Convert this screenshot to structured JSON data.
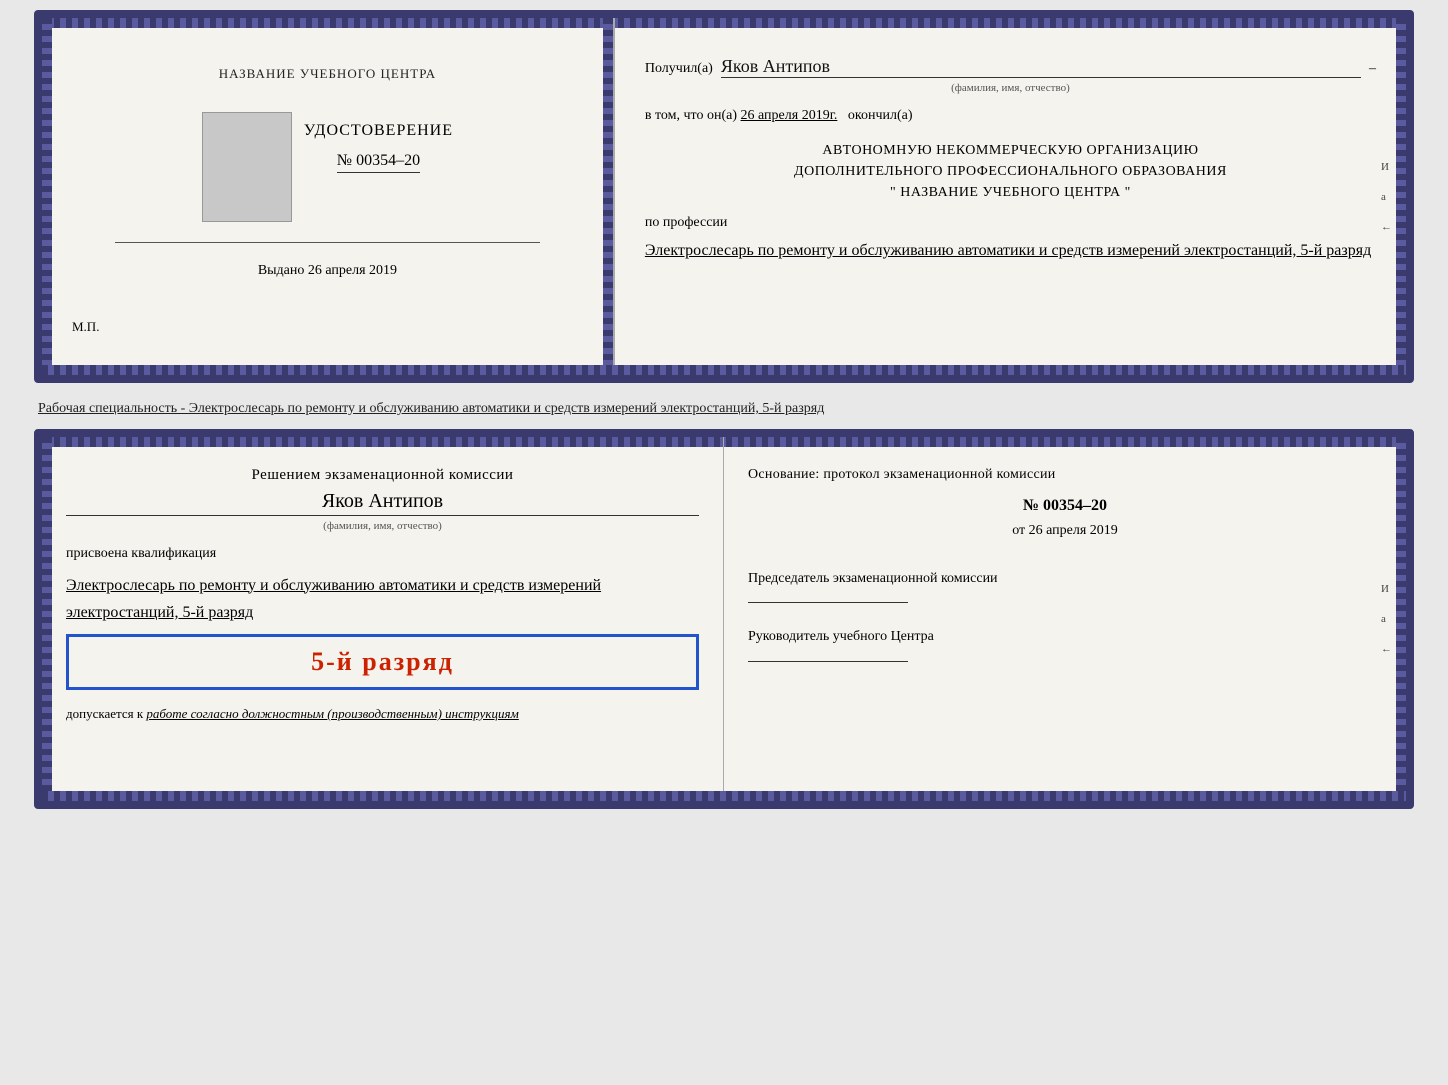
{
  "top_cert": {
    "left": {
      "org_name": "НАЗВАНИЕ УЧЕБНОГО ЦЕНТРА",
      "cert_title": "УДОСТОВЕРЕНИЕ",
      "cert_number": "№ 00354–20",
      "issued_label": "Выдано",
      "issued_date": "26 апреля 2019",
      "mp_label": "М.П."
    },
    "right": {
      "recipient_label": "Получил(а)",
      "recipient_name": "Яков Антипов",
      "fio_caption": "(фамилия, имя, отчество)",
      "completed_prefix": "в том, что он(а)",
      "completed_date": "26 апреля 2019г.",
      "completed_suffix": "окончил(а)",
      "org_line1": "АВТОНОМНУЮ НЕКОММЕРЧЕСКУЮ ОРГАНИЗАЦИЮ",
      "org_line2": "ДОПОЛНИТЕЛЬНОГО ПРОФЕССИОНАЛЬНОГО ОБРАЗОВАНИЯ",
      "org_line3": "\" НАЗВАНИЕ УЧЕБНОГО ЦЕНТРА \"",
      "profession_label": "по профессии",
      "profession_text": "Электрослесарь по ремонту и обслуживанию автоматики и средств измерений электростанций, 5-й разряд"
    }
  },
  "description": {
    "text": "Рабочая специальность - Электрослесарь по ремонту и обслуживанию автоматики и средств измерений электростанций, 5-й разряд"
  },
  "bottom_cert": {
    "left": {
      "decision_text": "Решением экзаменационной комиссии",
      "name": "Яков Антипов",
      "fio_caption": "(фамилия, имя, отчество)",
      "qualification_label": "присвоена квалификация",
      "qualification_text": "Электрослесарь по ремонту и обслуживанию автоматики и средств измерений электростанций, 5-й разряд",
      "rank_badge": "5-й разряд",
      "допускается_label": "допускается к",
      "допускается_text": "работе согласно должностным (производственным) инструкциям"
    },
    "right": {
      "basis_text": "Основание: протокол экзаменационной комиссии",
      "protocol_number": "№ 00354–20",
      "date_prefix": "от",
      "date_value": "26 апреля 2019",
      "chairman_label": "Председатель экзаменационной комиссии",
      "head_label": "Руководитель учебного Центра",
      "side_marks": [
        "И",
        "а",
        "←"
      ]
    }
  }
}
